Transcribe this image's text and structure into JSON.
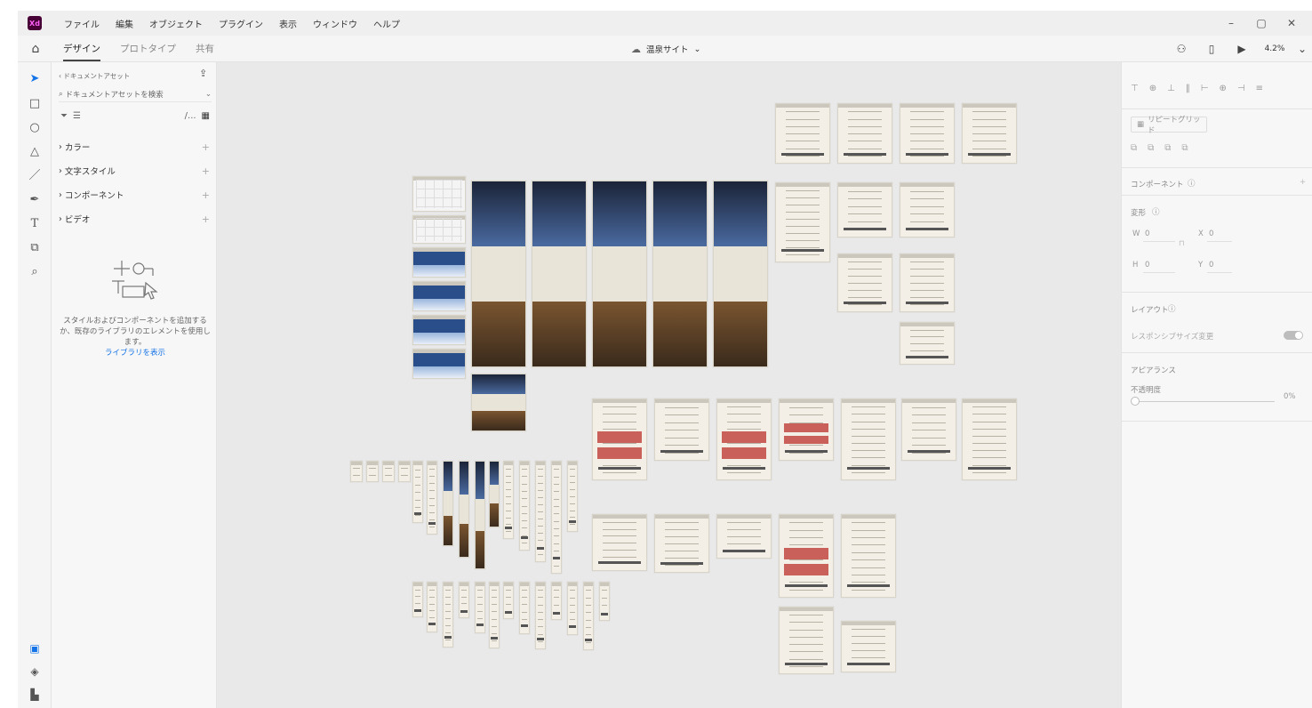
{
  "app": {
    "logo": "Xd",
    "menu": [
      "ファイル",
      "編集",
      "オブジェクト",
      "プラグイン",
      "表示",
      "ウィンドウ",
      "ヘルプ"
    ],
    "window_controls": [
      "–",
      "▢",
      "✕"
    ]
  },
  "toolbar": {
    "tabs": [
      "デザイン",
      "プロトタイプ",
      "共有"
    ],
    "active_tab": "デザイン",
    "document_title": "温泉サイト",
    "zoom": "4.2%"
  },
  "assets_panel": {
    "header": "ドキュメントアセット",
    "search_placeholder": "ドキュメントアセットを検索",
    "filter_text": "/...",
    "sections": [
      "カラー",
      "文字スタイル",
      "コンポーネント",
      "ビデオ"
    ],
    "empty_message": "スタイルおよびコンポーネントを追加するか、既存のライブラリのエレメントを使用します。",
    "library_link": "ライブラリを表示"
  },
  "properties_panel": {
    "repeat_grid": "リピートグリッド",
    "component": "コンポーネント",
    "transform": "変形",
    "w_label": "W",
    "w_value": "0",
    "x_label": "X",
    "x_value": "0",
    "h_label": "H",
    "h_value": "0",
    "y_label": "Y",
    "y_value": "0",
    "layout": "レイアウト",
    "responsive_resize": "レスポンシブサイズ変更",
    "appearance": "アピアランス",
    "opacity_label": "不透明度",
    "opacity_value": "0%"
  },
  "icons": {
    "tools": [
      "select-icon",
      "rectangle-icon",
      "ellipse-icon",
      "polygon-icon",
      "line-icon",
      "pen-icon",
      "text-icon",
      "artboard-icon",
      "zoom-icon"
    ],
    "bottom": [
      "assets-icon",
      "layers-icon",
      "plugins-icon"
    ]
  },
  "colors": {
    "accent": "#1473e6",
    "artboard": "#f3efe6",
    "canvas": "#e9e9e9"
  }
}
